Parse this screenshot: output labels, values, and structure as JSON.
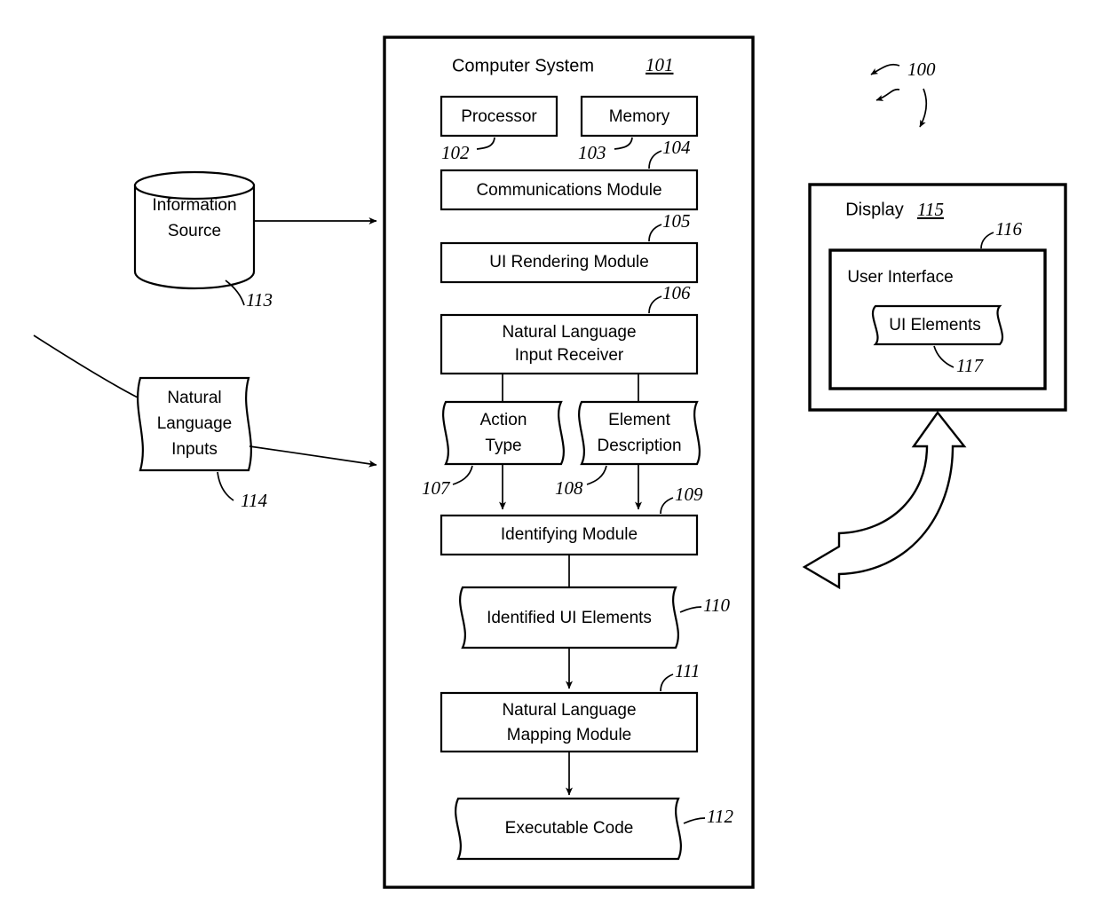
{
  "figure": {
    "ref_100": "100"
  },
  "computer_system": {
    "title": "Computer System",
    "ref": "101",
    "processor": {
      "label": "Processor",
      "ref": "102"
    },
    "memory": {
      "label": "Memory",
      "ref": "103"
    },
    "communications_module": {
      "label": "Communications Module",
      "ref": "104"
    },
    "ui_rendering_module": {
      "label": "UI Rendering Module",
      "ref": "105"
    },
    "nl_input_receiver": {
      "label_line1": "Natural Language",
      "label_line2": "Input Receiver",
      "ref": "106"
    },
    "action_type": {
      "label_line1": "Action",
      "label_line2": "Type",
      "ref": "107"
    },
    "element_description": {
      "label_line1": "Element",
      "label_line2": "Description",
      "ref": "108"
    },
    "identifying_module": {
      "label": "Identifying Module",
      "ref": "109"
    },
    "identified_ui_elements": {
      "label": "Identified UI Elements",
      "ref": "110"
    },
    "nl_mapping_module": {
      "label_line1": "Natural Language",
      "label_line2": "Mapping Module",
      "ref": "111"
    },
    "executable_code": {
      "label": "Executable Code",
      "ref": "112"
    }
  },
  "inputs": {
    "information_source": {
      "label_line1": "Information",
      "label_line2": "Source",
      "ref": "113"
    },
    "natural_language_inputs": {
      "label_line1": "Natural",
      "label_line2": "Language",
      "label_line3": "Inputs",
      "ref": "114"
    }
  },
  "display": {
    "title": "Display",
    "ref": "115",
    "user_interface": {
      "label": "User Interface",
      "ref": "116"
    },
    "ui_elements": {
      "label": "UI Elements",
      "ref": "117"
    }
  }
}
